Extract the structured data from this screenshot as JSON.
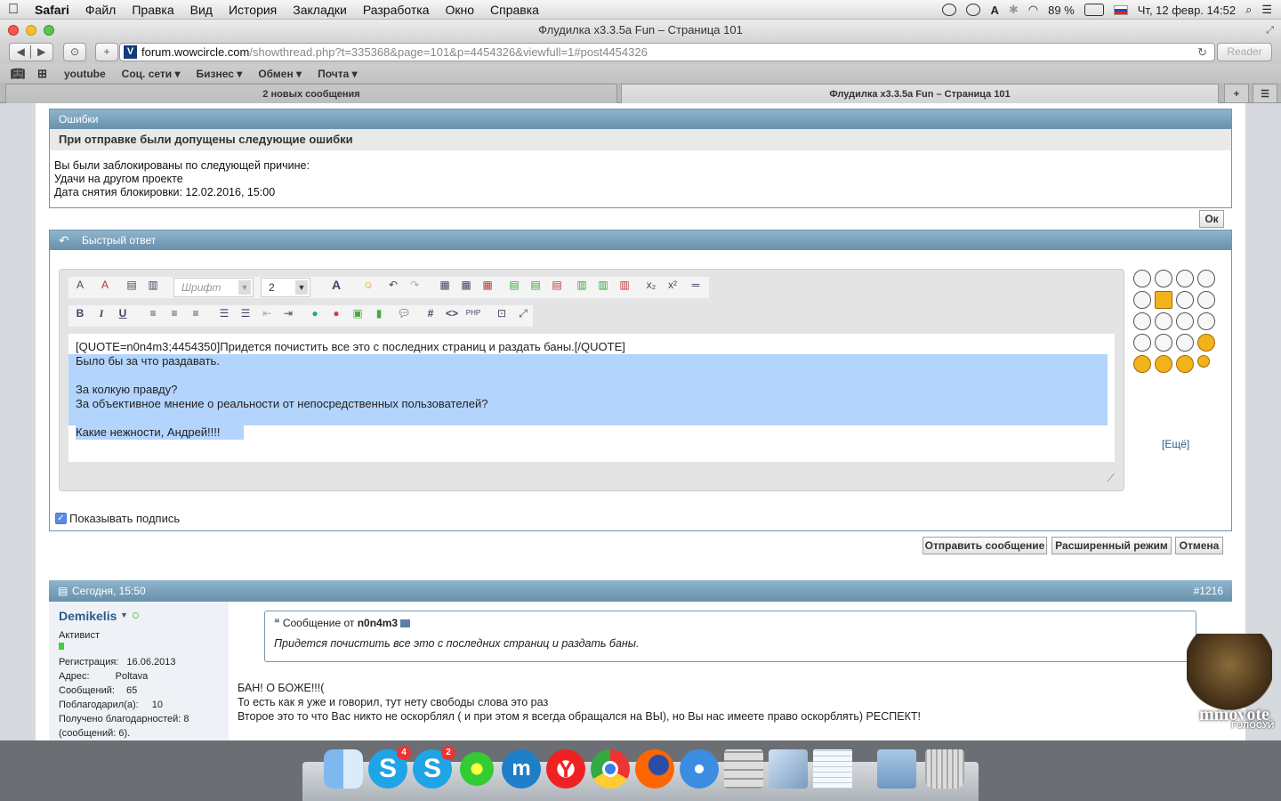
{
  "menubar": {
    "app": "Safari",
    "items": [
      "Файл",
      "Правка",
      "Вид",
      "История",
      "Закладки",
      "Разработка",
      "Окно",
      "Справка"
    ],
    "battery": "89 %",
    "datetime": "Чт, 12 февр.  14:52"
  },
  "window": {
    "title": "Флудилка x3.3.5a Fun – Страница 101"
  },
  "toolbar": {
    "url_host": "forum.wowcircle.com",
    "url_path": "/showthread.php?t=335368&page=101&p=4454326&viewfull=1#post4454326",
    "reader": "Reader"
  },
  "bookmarks": [
    "youtube",
    "Соц. сети",
    "Бизнес",
    "Обмен",
    "Почта"
  ],
  "tabs": [
    "2 новых сообщения",
    "Флудилка x3.3.5a Fun – Страница 101"
  ],
  "errors": {
    "header": "Ошибки",
    "title": "При отправке были допущены следующие ошибки",
    "line1": "Вы были заблокированы по следующей причине:",
    "line2": "Удачи на другом проекте",
    "line3": "Дата снятия блокировки: 12.02.2016, 15:00",
    "ok": "Ок"
  },
  "quick_reply": {
    "header": "Быстрый ответ",
    "font_placeholder": "Шрифт",
    "font_size": "2",
    "text_lines": [
      "[QUOTE=n0n4m3;4454350]Придется почистить все это с последних страниц и раздать баны.[/QUOTE]",
      "Было бы за что раздавать.",
      "",
      "За колкую правду?",
      "За объективное мнение о реальности от непосредственных пользователей?",
      "",
      "Какие нежности, Андрей!!!!"
    ],
    "more_smilies": "[Ещё]",
    "show_signature": "Показывать подпись",
    "submit": "Отправить сообщение",
    "advanced": "Расширенный режим",
    "cancel": "Отмена"
  },
  "post": {
    "date": "Сегодня, 15:50",
    "number": "#1216",
    "author": "Demikelis",
    "rank": "Активист",
    "reg_label": "Регистрация:",
    "reg_value": "16.06.2013",
    "addr_label": "Адрес:",
    "addr_value": "Poltava",
    "msgs_label": "Сообщений:",
    "msgs_value": "65",
    "thanked_label": "Поблагодарил(а):",
    "thanked_value": "10",
    "received": "Получено благодарностей: 8",
    "received2": "(сообщений: 6).",
    "quote_prefix": "Сообщение от",
    "quote_author": "n0n4m3",
    "quote_text": "Придется почистить все это с последних страниц и раздать баны.",
    "body": [
      "БАН! О БОЖЕ!!!(",
      "То есть как я уже и говорил, тут нету свободы слова это раз",
      "Второе это то что Вас никто не оскорблял ( и при этом я всегда обращался на ВЫ), но Вы нас имеете право оскорблять) РЕСПЕКТ!"
    ]
  },
  "mmovote": {
    "brand": "mmovote",
    "sub": "ГОЛОСУЙ"
  },
  "dock": {
    "skype_badge_1": "4",
    "skype_badge_2": "2"
  },
  "colors": {
    "panel_blue": "#6f97b3",
    "selection": "#b3d4fc",
    "link": "#2a5a8a"
  }
}
